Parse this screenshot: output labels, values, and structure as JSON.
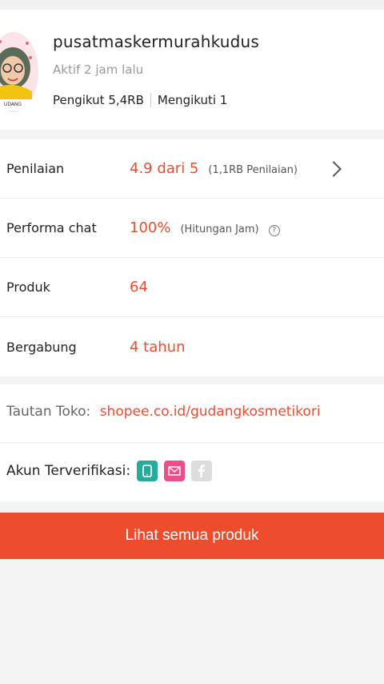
{
  "profile": {
    "shop_name": "pusatmaskermurahkudus",
    "active_status": "Aktif 2 jam lalu",
    "followers": "Pengikut 5,4RB",
    "following": "Mengikuti 1",
    "avatar_text": "UDANG"
  },
  "stats": [
    {
      "label": "Penilaian",
      "value": "4.9 dari 5",
      "sub": "(1,1RB Penilaian)"
    },
    {
      "label": "Performa chat",
      "value": "100%",
      "sub": "(Hitungan Jam)"
    },
    {
      "label": "Produk",
      "value": "64",
      "sub": ""
    },
    {
      "label": "Bergabung",
      "value": "4 tahun",
      "sub": ""
    }
  ],
  "links": {
    "shop_link_label": "Tautan Toko:",
    "shop_link_url": "shopee.co.id/gudangkosmetikori",
    "verified_label": "Akun Terverifikasi:"
  },
  "cta": {
    "label": "Lihat semua produk"
  },
  "colors": {
    "accent": "#ee4d2d",
    "phone": "#26aa99",
    "mail": "#ee4d8b",
    "facebook": "#dcdcdc"
  },
  "icons": {
    "rating_arrow": "chevron-right-icon",
    "chat_help": "help-circle-icon",
    "verify": [
      "phone-icon",
      "mail-icon",
      "facebook-icon"
    ]
  }
}
